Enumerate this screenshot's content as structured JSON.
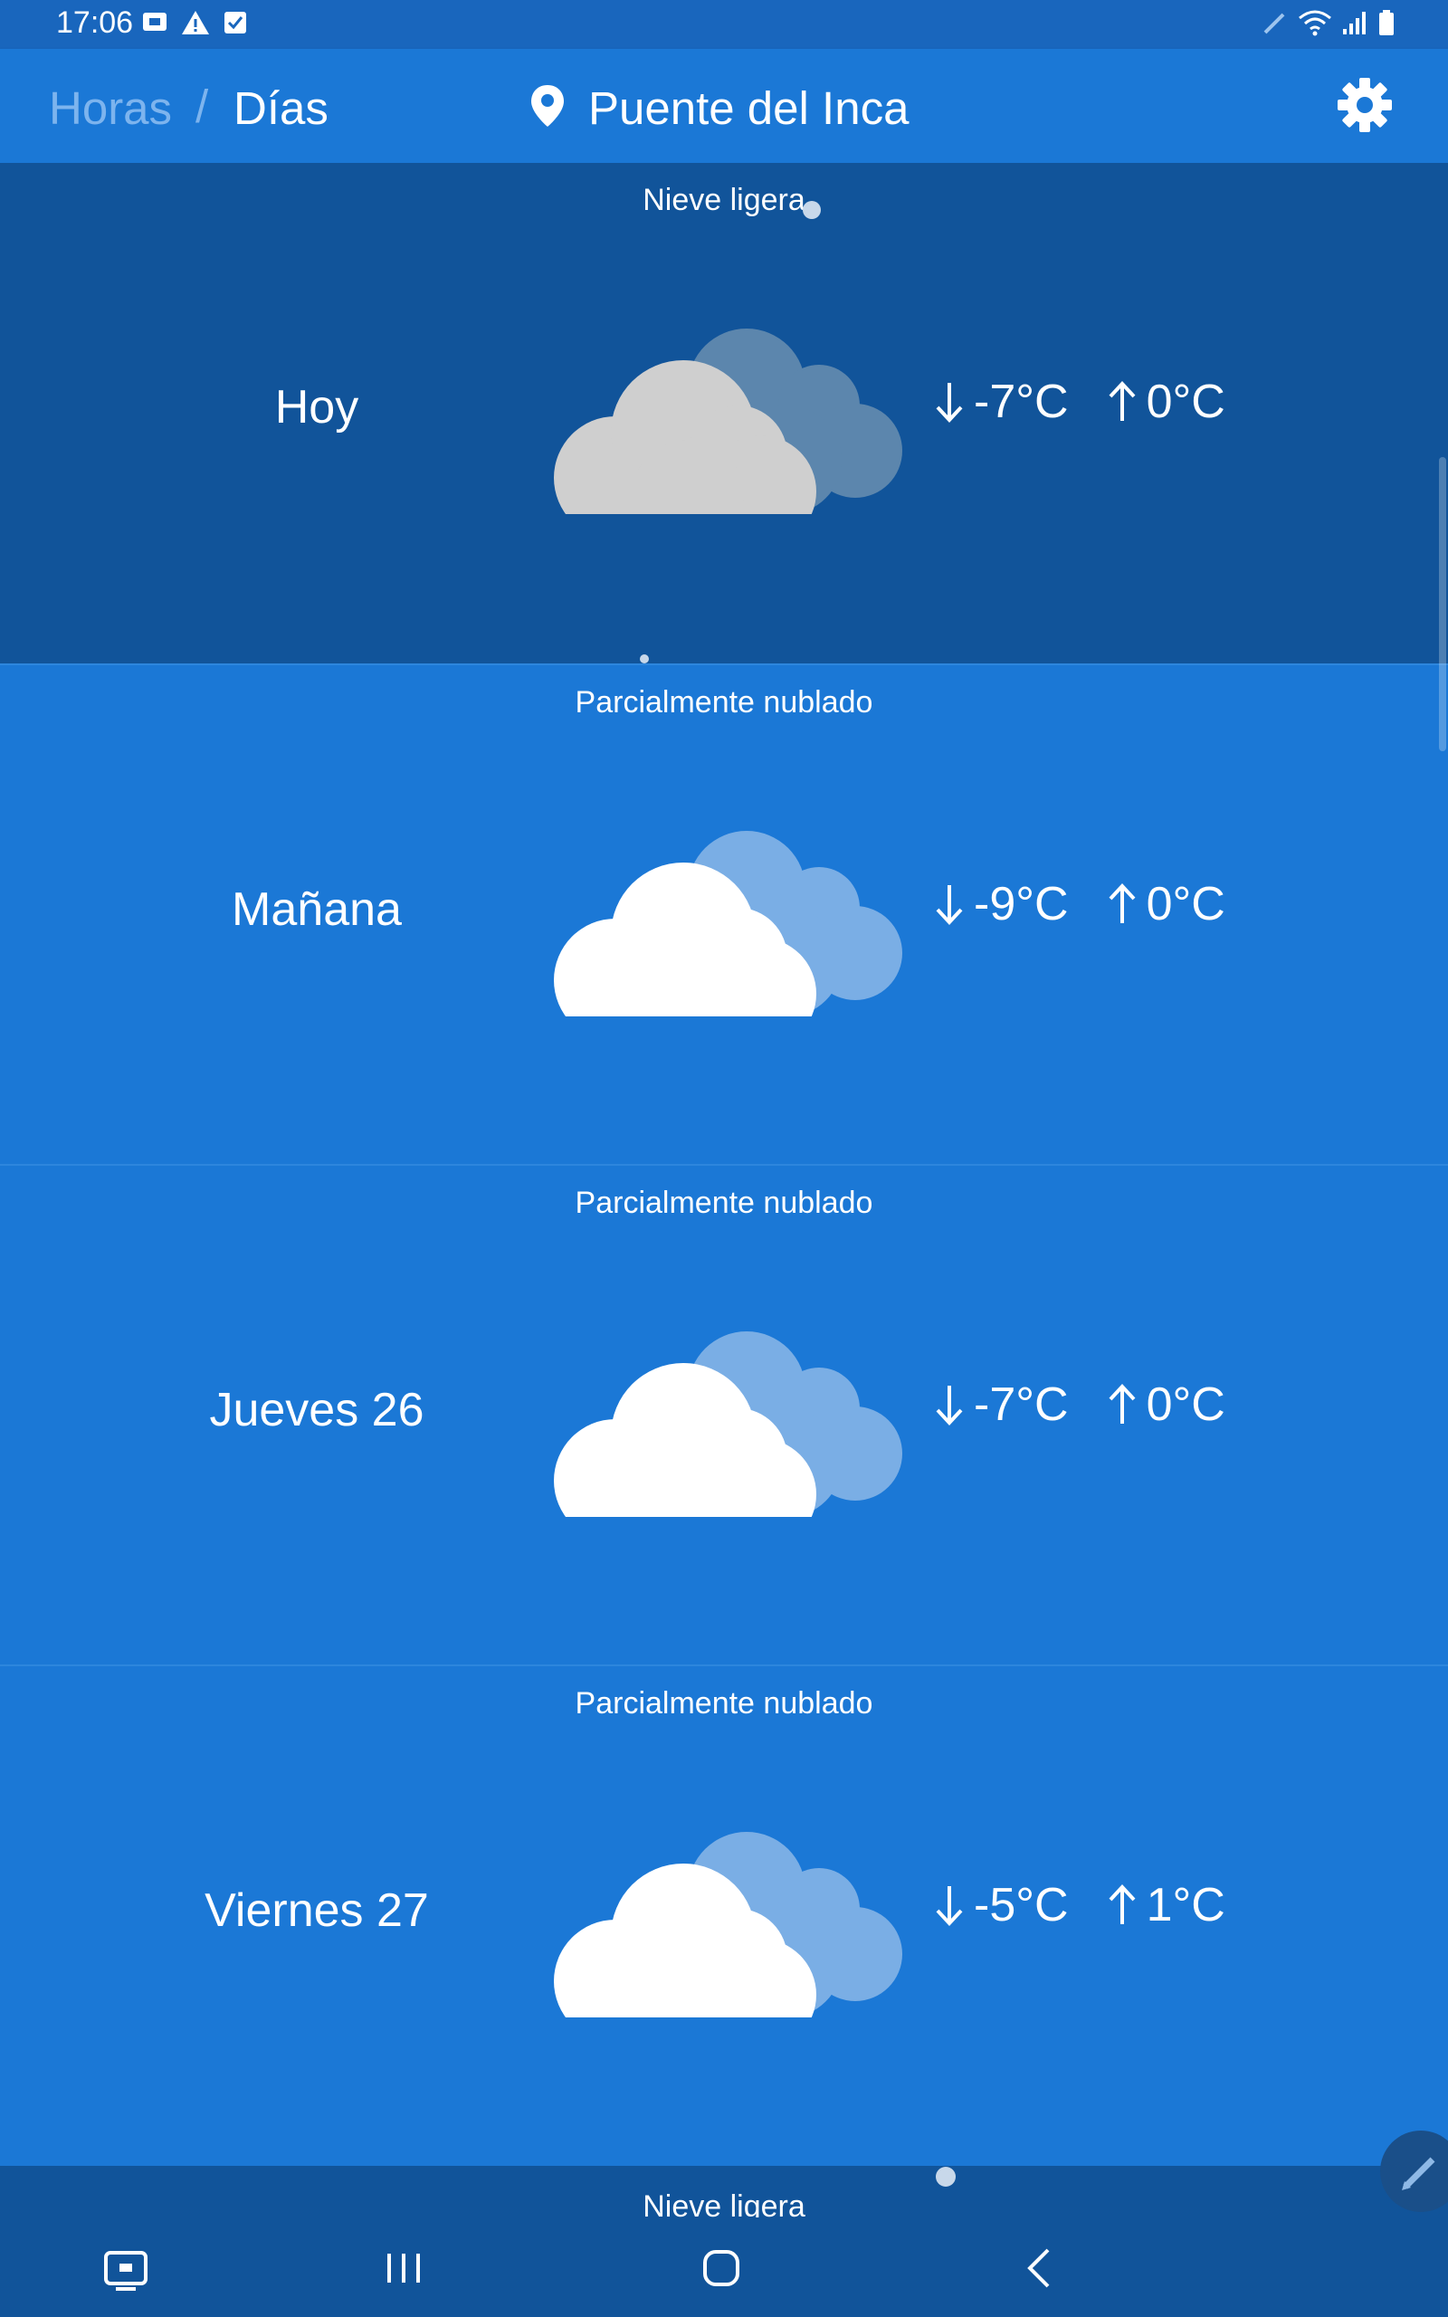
{
  "status_bar": {
    "time": "17:06",
    "left_icons": [
      "screen-record-icon",
      "warning-icon",
      "check-box-icon"
    ],
    "right_icons": [
      "pen-icon",
      "wifi-icon",
      "signal-icon",
      "battery-icon"
    ]
  },
  "app_bar": {
    "tab_hours": "Horas",
    "separator": "/",
    "tab_days": "Días",
    "location_icon": "location-pin-icon",
    "location": "Puente del Inca",
    "settings_icon": "gear-icon"
  },
  "days": [
    {
      "day": "Hoy",
      "condition": "Nieve ligera",
      "min": "-7°C",
      "max": "0°C",
      "icon": "snow-cloud-icon"
    },
    {
      "day": "Mañana",
      "condition": "Parcialmente nublado",
      "min": "-9°C",
      "max": "0°C",
      "icon": "partly-cloudy-icon"
    },
    {
      "day": "Jueves 26",
      "condition": "Parcialmente nublado",
      "min": "-7°C",
      "max": "0°C",
      "icon": "partly-cloudy-icon"
    },
    {
      "day": "Viernes 27",
      "condition": "Parcialmente nublado",
      "min": "-5°C",
      "max": "1°C",
      "icon": "partly-cloudy-icon"
    }
  ],
  "next_day_peek": {
    "condition": "Nieve ligera"
  },
  "nav_bar": {
    "icons": [
      "recent-screen-icon",
      "recents-icon",
      "home-icon",
      "back-icon"
    ]
  },
  "fab": {
    "icon": "pencil-icon"
  },
  "colors": {
    "primary": "#1b78d6",
    "selected_row": "#11549a",
    "status_bar": "#1966bd",
    "cloud_white": "#ffffff",
    "cloud_gray": "#cfcfcf",
    "cloud_back_light": "#7aaee5",
    "cloud_back_dark": "#5c86ad"
  }
}
